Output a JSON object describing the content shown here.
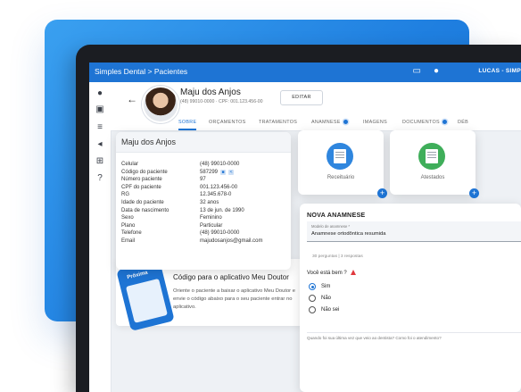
{
  "topbar": {
    "breadcrumb": "Simples Dental > Pacientes",
    "user": "LUCAS - SIMP",
    "icons": [
      "monitor-icon",
      "bell-icon"
    ]
  },
  "sidebar": {
    "icons": [
      "person-icon",
      "calendar-icon",
      "finance-icon",
      "megaphone-icon",
      "cart-icon",
      "help-icon"
    ]
  },
  "patient": {
    "name": "Maju dos Anjos",
    "subtitle": "(48) 99010-0000 · CPF: 001.123.456-00",
    "edit_label": "EDITAR"
  },
  "tabs": [
    {
      "label": "SOBRE",
      "active": true
    },
    {
      "label": "ORÇAMENTOS"
    },
    {
      "label": "TRATAMENTOS"
    },
    {
      "label": "ANAMNESE"
    },
    {
      "label": "IMAGENS"
    },
    {
      "label": "DOCUMENTOS"
    },
    {
      "label": "DÉB"
    }
  ],
  "info_card": {
    "title": "Maju dos Anjos",
    "rows": [
      {
        "key": "Celular",
        "value": "(48) 99010-0000"
      },
      {
        "key": "Código do paciente",
        "value": "587299"
      },
      {
        "key": "Número paciente",
        "value": "97"
      },
      {
        "key": "CPF do paciente",
        "value": "001.123.456-00"
      },
      {
        "key": "RG",
        "value": "12.345.678-0"
      },
      {
        "key": "Idade do paciente",
        "value": "32 anos"
      },
      {
        "key": "Data de nascimento",
        "value": "13 de jun. de 1990"
      },
      {
        "key": "Sexo",
        "value": "Feminino"
      },
      {
        "key": "Plano",
        "value": "Particular"
      },
      {
        "key": "Telefone",
        "value": "(48) 99010-0000"
      },
      {
        "key": "Email",
        "value": "majudosanjos@gmail.com"
      }
    ]
  },
  "app_card": {
    "phone_text": "Próxima",
    "title": "Código para o aplicativo Meu Doutor",
    "description": "Oriente o paciente a baixar o aplicativo Meu Doutor e envie o código abaixo para o seu paciente entrar no aplicativo."
  },
  "tiles": [
    {
      "label": "Receituário",
      "color": "#2f86de"
    },
    {
      "label": "Atestados",
      "color": "#3fae5a"
    }
  ],
  "anamnese": {
    "title": "NOVA ANAMNESE",
    "select_label": "Modelo de anamnese *",
    "select_value": "Anamnese ortodôntica resumida",
    "meta": "30 perguntas  |  3 respostas",
    "question": "Você está bem ?",
    "options": [
      "Sim",
      "Não",
      "Não sei"
    ],
    "selected": "Sim",
    "question2": "Quando foi sua última vez que veio ao dentista? Como foi o atendimento?"
  },
  "colors": {
    "accent": "#1e74d4",
    "background_gradient": "#2a8fe8"
  }
}
